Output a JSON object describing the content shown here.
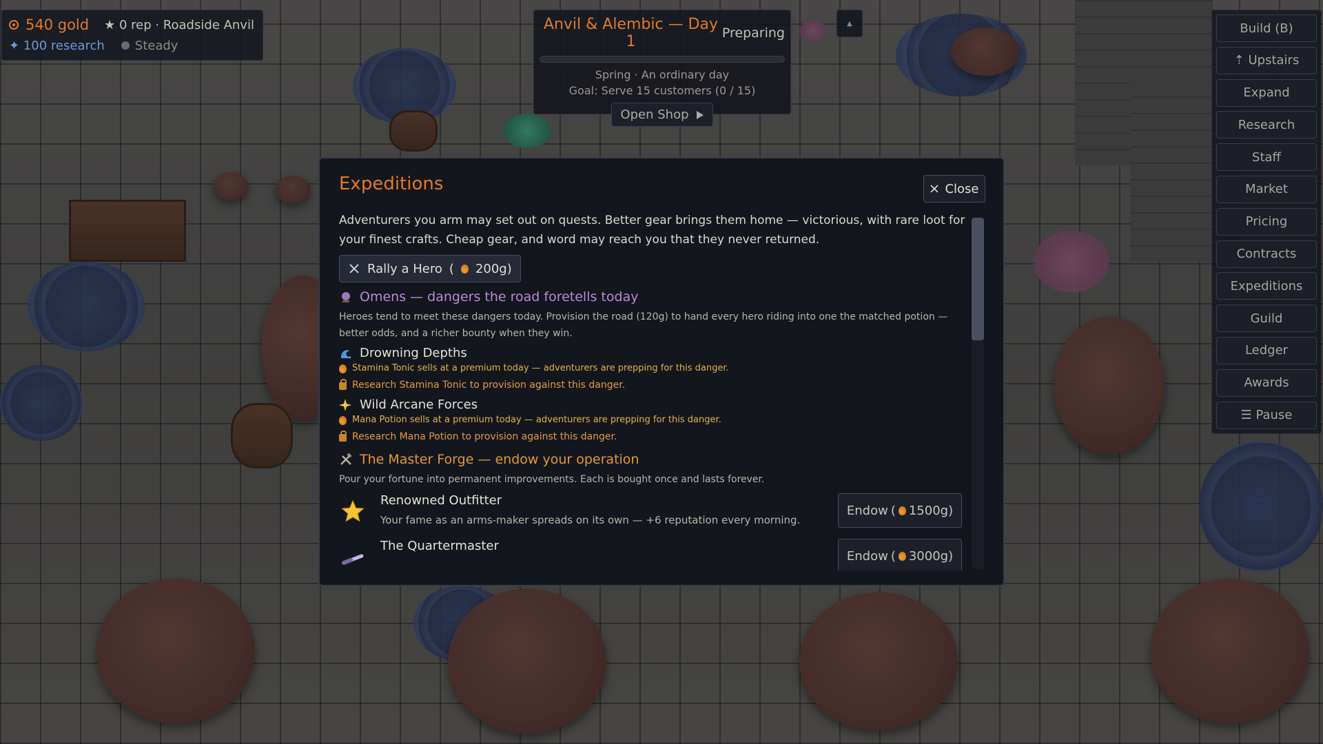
{
  "hud": {
    "gold": "540 gold",
    "rep": "★ 0 rep · Roadside Anvil",
    "research": "✦ 100 research",
    "mood": "Steady"
  },
  "day": {
    "title": "Anvil & Alembic — Day 1",
    "status": "Preparing",
    "season": "Spring · An ordinary day",
    "goal": "Goal: Serve 15 customers  (0 / 15)",
    "open_shop": "Open Shop",
    "progress": 0,
    "collapse": "▲"
  },
  "menu": {
    "items": [
      "Build (B)",
      "⇡ Upstairs",
      "Expand",
      "Research",
      "Staff",
      "Market",
      "Pricing",
      "Contracts",
      "Expeditions",
      "Guild",
      "Ledger",
      "Awards",
      "☰ Pause"
    ]
  },
  "modal": {
    "title": "Expeditions",
    "close": "Close",
    "intro": "Adventurers you arm may set out on quests. Better gear brings them home — victorious, with rare loot for your finest crafts. Cheap gear, and word may reach you that they never returned.",
    "rally_label": "Rally a Hero",
    "rally_open": "(",
    "rally_cost": "200g)",
    "omens": {
      "title": "Omens — dangers the road foretells today",
      "desc": "Heroes tend to meet these dangers today. Provision the road (120g) to hand every hero riding into one the matched potion — better odds, and a richer bounty when they win."
    },
    "dangers": [
      {
        "name": "Drowning Depths",
        "icon": "wave-icon",
        "premium": "Stamina Tonic sells at a premium today — adventurers are prepping for this danger.",
        "research": "Research Stamina Tonic to provision against this danger."
      },
      {
        "name": "Wild Arcane Forces",
        "icon": "sparkle-icon",
        "premium": "Mana Potion sells at a premium today — adventurers are prepping for this danger.",
        "research": "Research Mana Potion to provision against this danger."
      }
    ],
    "forge": {
      "title": "The Master Forge — endow your operation",
      "desc": "Pour your fortune into permanent improvements. Each is bought once and lasts forever."
    },
    "upgrades": [
      {
        "name": "Renowned Outfitter",
        "desc": "Your fame as an arms-maker spreads on its own — +6 reputation every morning.",
        "endow": "Endow",
        "open": "(",
        "cost": "1500g)",
        "icon": "star-icon"
      },
      {
        "name": "The Quartermaster",
        "desc": "",
        "endow": "Endow",
        "open": "(",
        "cost": "3000g)",
        "icon": "spyglass-icon"
      }
    ]
  },
  "colors": {
    "accent": "#e07a2a",
    "omens": "#b98bd8",
    "research_blue": "#6a9ad8",
    "premium": "#e0b34a"
  }
}
